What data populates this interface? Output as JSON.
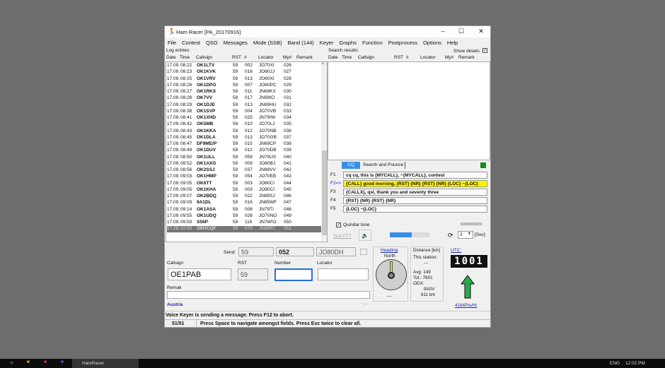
{
  "window": {
    "title": "Ham Racer [PA_20170916]",
    "minimize": "–",
    "maximize": "☐",
    "close": "✕"
  },
  "menu": [
    "File",
    "Contest",
    "QSO",
    "Messages",
    "Mode (SSB)",
    "Band (144)",
    "Keyer",
    "Graphs",
    "Function",
    "Postprocess",
    "Options",
    "Help"
  ],
  "log": {
    "label": "Log entries:",
    "columns": [
      "Date",
      "Time",
      "Callsign",
      "RST",
      "#",
      "Locator",
      "My#",
      "Remark"
    ],
    "rows": [
      [
        "17.09.",
        "08:22",
        "OK1LTV",
        "59",
        "002",
        "JO70XI",
        "026"
      ],
      [
        "17.09.",
        "08:23",
        "OK1KVK",
        "59",
        "016",
        "JO60JJ",
        "027"
      ],
      [
        "17.09.",
        "08:25",
        "OK1VRV",
        "59",
        "013",
        "JO60XI",
        "028"
      ],
      [
        "17.09.",
        "08:26",
        "OK1DPO",
        "59",
        "007",
        "JO60PC",
        "029"
      ],
      [
        "17.09.",
        "08:27",
        "OK1RKS",
        "59",
        "011",
        "JN69KX",
        "030"
      ],
      [
        "17.09.",
        "08:28",
        "OK7VV",
        "59",
        "017",
        "JN99IO",
        "031"
      ],
      [
        "17.09.",
        "08:29",
        "OK1DJE",
        "59",
        "013",
        "JN89HU",
        "032"
      ],
      [
        "17.09.",
        "08:38",
        "OK1SVP",
        "59",
        "004",
        "JO70VB",
        "033"
      ],
      [
        "17.09.",
        "08:41",
        "OK1XHD",
        "59",
        "025",
        "JN79IW",
        "034"
      ],
      [
        "17.09.",
        "08:42",
        "OK5MB",
        "59",
        "010",
        "JO70LJ",
        "035"
      ],
      [
        "17.09.",
        "08:43",
        "OK1KKA",
        "59",
        "012",
        "JO70NB",
        "036"
      ],
      [
        "17.09.",
        "08:45",
        "OK1DLA",
        "59",
        "013",
        "JO70GB",
        "037"
      ],
      [
        "17.09.",
        "08:47",
        "DF9ME/P",
        "59",
        "015",
        "JN69CP",
        "038"
      ],
      [
        "17.09.",
        "08:49",
        "OK1DUV",
        "59",
        "012",
        "JO70DB",
        "039"
      ],
      [
        "17.09.",
        "08:50",
        "OK1ULL",
        "59",
        "059",
        "JN79US",
        "040"
      ],
      [
        "17.09.",
        "08:52",
        "OK1AXG",
        "59",
        "009",
        "JO80BJ",
        "041"
      ],
      [
        "17.09.",
        "08:56",
        "OK2SSJ",
        "59",
        "037",
        "JN89VV",
        "042"
      ],
      [
        "17.09.",
        "09:03",
        "OK1HMP",
        "59",
        "054",
        "JO70EB",
        "043"
      ],
      [
        "17.09.",
        "09:05",
        "OK6TT",
        "59",
        "003",
        "JO80CI",
        "044"
      ],
      [
        "17.09.",
        "09:05",
        "OK1KHA",
        "59",
        "003",
        "JO80CI",
        "045"
      ],
      [
        "17.09.",
        "09:07",
        "OK2BDQ",
        "59",
        "022",
        "JN89SJ",
        "046"
      ],
      [
        "17.09.",
        "09:09",
        "9A1DL",
        "59",
        "016",
        "JN85WF",
        "047"
      ],
      [
        "17.09.",
        "09:14",
        "OK1ASA",
        "59",
        "008",
        "JN79TI",
        "048"
      ],
      [
        "17.09.",
        "09:55",
        "OK1UDQ",
        "59",
        "026",
        "JO70NO",
        "049"
      ],
      [
        "17.09.",
        "09:59",
        "S56P",
        "59",
        "116",
        "JN76PO",
        "050"
      ],
      [
        "17.09.",
        "10:00",
        "OM3CQF",
        "59",
        "070",
        "JN88RT",
        "051"
      ]
    ]
  },
  "search": {
    "label": "Search results:",
    "show_details": "Show details",
    "columns": [
      "Date",
      "Time",
      "Callsign",
      "RST",
      "#",
      "Locator",
      "My#",
      "Remark"
    ]
  },
  "keyer": {
    "tabs": [
      "CQ",
      "Search and Pounce"
    ],
    "status_color": "#1a8a1a",
    "messages": [
      {
        "key": "F1",
        "text": "cq cq, this is {MYCALL}, ~{MYCALL}, contest"
      },
      {
        "key": "F2=>",
        "text": "{CALL} good morning, {RST} {NR} {RST} {NR} {LOC} ~{LOC}",
        "active": true
      },
      {
        "key": "F3",
        "text": "{CALLX}, qsl, thank you and seventy three"
      },
      {
        "key": "F4",
        "text": "{RST} {NR} {RST} {NR}"
      },
      {
        "key": "F5",
        "text": "{LOC} ~{LOC}"
      }
    ],
    "quindar": "Quindar tone",
    "counter": "0000000000",
    "test_ptt": "Test PTT",
    "repeat": "3",
    "sec": "[Sec]",
    "progress": 0.55
  },
  "entry": {
    "send_label": "Send:",
    "send_rst": "59",
    "send_number": "052",
    "send_locator": "JO80DH",
    "callsign_label": "Callsign",
    "callsign": "OE1PAB",
    "rst_label": "RST",
    "rst": "59",
    "number_label": "Number",
    "number": "",
    "locator_label": "Locator",
    "locator": "",
    "remark_label": "Remak",
    "remark": "",
    "country": "Austria",
    "dash": "---"
  },
  "heading": {
    "label": "Heading",
    "direction": "North",
    "value": "---"
  },
  "distance": {
    "label": "Distance [km]",
    "this_station": "This station:",
    "this_value": "---",
    "avg": "Avg:  149",
    "tot": "Tot.: 7601",
    "odx": "ODX:",
    "odx_call": "9A0V",
    "odx_km": "611 km"
  },
  "utc": {
    "label": "UTC:",
    "time": "1001",
    "rate": "4164Pts/Hr"
  },
  "status": {
    "message": "Voice Keyer is sending a message. Press F12 to abort.",
    "count": "51/51",
    "hint": "Press Space to navigate amongst fields. Press Esc twice to clear all."
  },
  "taskbar": {
    "app": "HamRacer",
    "lang": "ENG",
    "time": "12:02 PM"
  }
}
